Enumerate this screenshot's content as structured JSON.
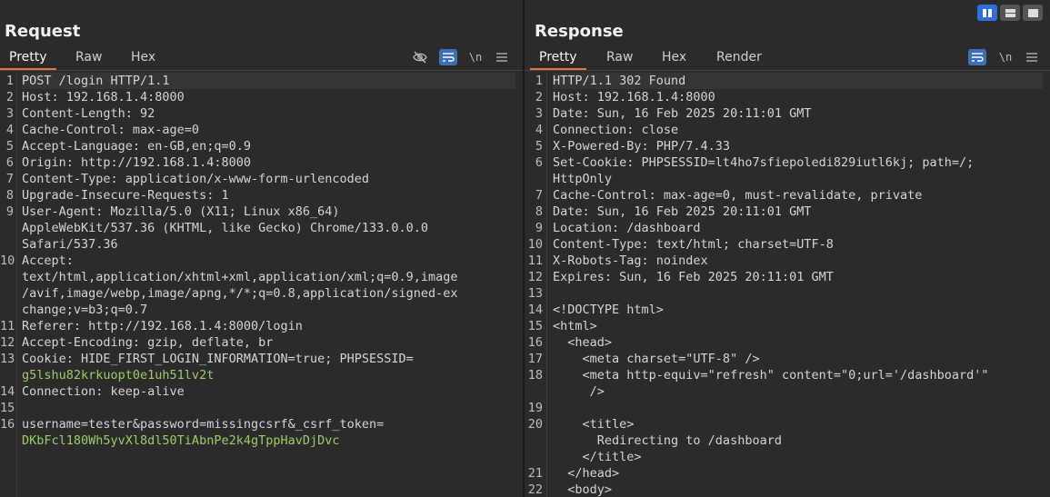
{
  "request": {
    "title": "Request",
    "tabs": [
      "Pretty",
      "Raw",
      "Hex"
    ],
    "lines": [
      {
        "n": "1",
        "t": "POST /login HTTP/1.1"
      },
      {
        "n": "2",
        "t": "Host: 192.168.1.4:8000"
      },
      {
        "n": "3",
        "t": "Content-Length: 92"
      },
      {
        "n": "4",
        "t": "Cache-Control: max-age=0"
      },
      {
        "n": "5",
        "t": "Accept-Language: en-GB,en;q=0.9"
      },
      {
        "n": "6",
        "t": "Origin: http://192.168.1.4:8000"
      },
      {
        "n": "7",
        "t": "Content-Type: application/x-www-form-urlencoded"
      },
      {
        "n": "8",
        "t": "Upgrade-Insecure-Requests: 1"
      },
      {
        "n": "9",
        "t": "User-Agent: Mozilla/5.0 (X11; Linux x86_64)"
      },
      {
        "n": "",
        "t": "AppleWebKit/537.36 (KHTML, like Gecko) Chrome/133.0.0.0"
      },
      {
        "n": "",
        "t": "Safari/537.36"
      },
      {
        "n": "10",
        "t": "Accept:"
      },
      {
        "n": "",
        "t": "text/html,application/xhtml+xml,application/xml;q=0.9,image"
      },
      {
        "n": "",
        "t": "/avif,image/webp,image/apng,*/*;q=0.8,application/signed-ex"
      },
      {
        "n": "",
        "t": "change;v=b3;q=0.7"
      },
      {
        "n": "11",
        "t": "Referer: http://192.168.1.4:8000/login"
      },
      {
        "n": "12",
        "t": "Accept-Encoding: gzip, deflate, br"
      },
      {
        "n": "13",
        "t": "Cookie: HIDE_FIRST_LOGIN_INFORMATION=true; PHPSESSID="
      },
      {
        "n": "",
        "t": "g5lshu82krkuopt0e1uh51lv2t"
      },
      {
        "n": "14",
        "t": "Connection: keep-alive"
      },
      {
        "n": "15",
        "t": ""
      },
      {
        "n": "16",
        "t": "username=tester&password=missingcsrf&_csrf_token="
      },
      {
        "n": "",
        "t": "DKbFcl180Wh5yvXl8dl50TiAbnPe2k4gTppHavDjDvc"
      }
    ]
  },
  "response": {
    "title": "Response",
    "tabs": [
      "Pretty",
      "Raw",
      "Hex",
      "Render"
    ],
    "lines": [
      {
        "n": "1",
        "t": "HTTP/1.1 302 Found"
      },
      {
        "n": "2",
        "t": "Host: 192.168.1.4:8000"
      },
      {
        "n": "3",
        "t": "Date: Sun, 16 Feb 2025 20:11:01 GMT"
      },
      {
        "n": "4",
        "t": "Connection: close"
      },
      {
        "n": "5",
        "t": "X-Powered-By: PHP/7.4.33"
      },
      {
        "n": "6",
        "t": "Set-Cookie: PHPSESSID=lt4ho7sfiepoledi829iutl6kj; path=/;"
      },
      {
        "n": "",
        "t": "HttpOnly"
      },
      {
        "n": "7",
        "t": "Cache-Control: max-age=0, must-revalidate, private"
      },
      {
        "n": "8",
        "t": "Date: Sun, 16 Feb 2025 20:11:01 GMT"
      },
      {
        "n": "9",
        "t": "Location: /dashboard"
      },
      {
        "n": "10",
        "t": "Content-Type: text/html; charset=UTF-8"
      },
      {
        "n": "11",
        "t": "X-Robots-Tag: noindex"
      },
      {
        "n": "12",
        "t": "Expires: Sun, 16 Feb 2025 20:11:01 GMT"
      },
      {
        "n": "13",
        "t": ""
      },
      {
        "n": "14",
        "t": "<!DOCTYPE html>"
      },
      {
        "n": "15",
        "t": "<html>"
      },
      {
        "n": "16",
        "t": "  <head>"
      },
      {
        "n": "17",
        "t": "    <meta charset=\"UTF-8\" />"
      },
      {
        "n": "18",
        "t": "    <meta http-equiv=\"refresh\" content=\"0;url='/dashboard'\""
      },
      {
        "n": "",
        "t": "     />"
      },
      {
        "n": "19",
        "t": ""
      },
      {
        "n": "20",
        "t": "    <title>"
      },
      {
        "n": "",
        "t": "      Redirecting to /dashboard"
      },
      {
        "n": "",
        "t": "    </title>"
      },
      {
        "n": "21",
        "t": "  </head>"
      },
      {
        "n": "22",
        "t": "  <body>"
      }
    ]
  },
  "icons": {
    "hide": "eye-slash-icon",
    "wrap": "word-wrap-icon",
    "newline": "\\n",
    "menu": "menu-icon"
  }
}
